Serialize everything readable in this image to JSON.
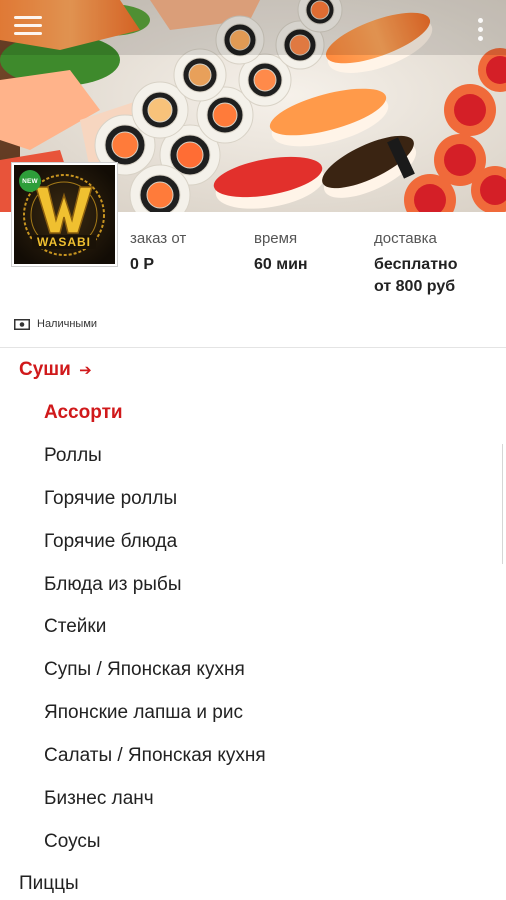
{
  "header": {
    "menu_icon": "hamburger-menu-icon",
    "search_icon": "search-icon",
    "more_icon": "more-vert-icon"
  },
  "restaurant": {
    "logo_text": "WASABI",
    "badge": "NEW"
  },
  "info": {
    "min_order_label": "заказ от",
    "min_order_value": "0 Р",
    "time_label": "время",
    "time_value": "60 мин",
    "delivery_label": "доставка",
    "delivery_value_line1": "бесплатно",
    "delivery_value_line2": "от 800 руб"
  },
  "payment": {
    "icon": "cash-icon",
    "label": "Наличными"
  },
  "menu": {
    "category_active": "Суши",
    "arrow": "➔",
    "subcategories": [
      "Ассорти",
      "Роллы",
      "Горячие роллы",
      "Горячие блюда",
      "Блюда из рыбы",
      "Стейки",
      "Супы / Японская кухня",
      "Японские лапша и рис",
      "Салаты / Японская кухня",
      "Бизнес ланч",
      "Соусы"
    ],
    "next_category": "Пиццы"
  },
  "colors": {
    "accent": "#d0191b",
    "text": "#222222",
    "muted": "#555555"
  }
}
